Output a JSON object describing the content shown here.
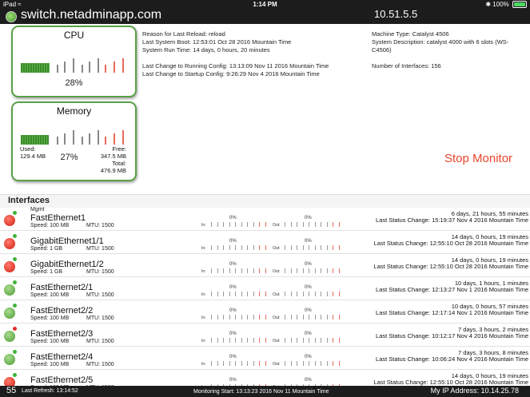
{
  "status_bar": {
    "device": "iPad",
    "time": "1:14 PM",
    "battery": "100%"
  },
  "header": {
    "hostname": "switch.netadminapp.com",
    "ip": "10.51.5.5"
  },
  "cpu": {
    "title": "CPU",
    "percent": "28%",
    "level": 0.28
  },
  "memory": {
    "title": "Memory",
    "percent": "27%",
    "level": 0.27,
    "used_label": "Used:",
    "used": "129.4 MB",
    "free_label": "Free:",
    "free": "347.5 MB",
    "total_label": "Total:",
    "total": "476.9 MB"
  },
  "system_info": {
    "reload_reason": "Reason for Last Reload: reload",
    "last_boot": "Last System Boot: 12:53:01 Oct 28 2016 Mountain Time",
    "run_time": "System Run Time: 14 days, 0 hours, 20 minutes",
    "running_config": "Last Change to Running Config: 13:13:09 Nov 11 2016 Mountain Time",
    "startup_config": "Last Change to Startup Config: 9:26:29 Nov 4 2016 Mountain Time",
    "machine_type": "Machine Type: Catalyst 4506",
    "description_line1": "System Description: catalyst 4000 with 6 slots (WS-",
    "description_line2": "C4506)",
    "interfaces_count": "Number of Interfaces: 156"
  },
  "stop_monitor_label": "Stop Monitor",
  "interfaces_title": "Interfaces",
  "interfaces": [
    {
      "status": "red",
      "badge": "g",
      "alias": "Mgmt",
      "name": "FastEthernet1",
      "speed": "Speed: 100 MB",
      "mtu": "MTU: 1500",
      "in_pct": "0%",
      "out_pct": "0%",
      "uptime": "6 days, 21 hours, 55 minutes",
      "last_change": "Last Status Change: 15:19:37 Nov 4 2016 Mountain Time"
    },
    {
      "status": "red",
      "badge": "g",
      "alias": "",
      "name": "GigabitEthernet1/1",
      "speed": "Speed: 1 GB",
      "mtu": "MTU: 1500",
      "in_pct": "0%",
      "out_pct": "0%",
      "uptime": "14 days, 0 hours, 19 minutes",
      "last_change": "Last Status Change: 12:55:10 Oct 28 2016 Mountain Time"
    },
    {
      "status": "red",
      "badge": "g",
      "alias": "",
      "name": "GigabitEthernet1/2",
      "speed": "Speed: 1 GB",
      "mtu": "MTU: 1500",
      "in_pct": "0%",
      "out_pct": "0%",
      "uptime": "14 days, 0 hours, 19 minutes",
      "last_change": "Last Status Change: 12:55:10 Oct 28 2016 Mountain Time"
    },
    {
      "status": "green",
      "badge": "g",
      "alias": "",
      "name": "FastEthernet2/1",
      "speed": "Speed: 100 MB",
      "mtu": "MTU: 1500",
      "in_pct": "0%",
      "out_pct": "0%",
      "uptime": "10 days, 1 hours, 1 minutes",
      "last_change": "Last Status Change: 12:13:27 Nov 1 2016 Mountain Time"
    },
    {
      "status": "green",
      "badge": "g",
      "alias": "",
      "name": "FastEthernet2/2",
      "speed": "Speed: 100 MB",
      "mtu": "MTU: 1500",
      "in_pct": "0%",
      "out_pct": "0%",
      "uptime": "10 days, 0 hours, 57 minutes",
      "last_change": "Last Status Change: 12:17:14 Nov 1 2016 Mountain Time"
    },
    {
      "status": "green",
      "badge": "r",
      "alias": "",
      "name": "FastEthernet2/3",
      "speed": "Speed: 100 MB",
      "mtu": "MTU: 1500",
      "in_pct": "0%",
      "out_pct": "0%",
      "uptime": "7 days, 3 hours, 2 minutes",
      "last_change": "Last Status Change: 10:12:17 Nov 4 2016 Mountain Time"
    },
    {
      "status": "green",
      "badge": "g",
      "alias": "",
      "name": "FastEthernet2/4",
      "speed": "Speed: 100 MB",
      "mtu": "MTU: 1500",
      "in_pct": "0%",
      "out_pct": "0%",
      "uptime": "7 days, 3 hours, 8 minutes",
      "last_change": "Last Status Change: 10:06:24 Nov 4 2016 Mountain Time"
    },
    {
      "status": "red",
      "badge": "g",
      "alias": "",
      "name": "FastEthernet2/5",
      "speed": "Speed: 100 MB",
      "mtu": "MTU: 1500",
      "in_pct": "0%",
      "out_pct": "0%",
      "uptime": "14 days, 0 hours, 19 minutes",
      "last_change": "Last Status Change: 12:55:10 Oct 28 2016 Mountain Time"
    }
  ],
  "row_labels": {
    "in": "In:",
    "out": "Out:"
  },
  "footer": {
    "count": "55",
    "last_refresh": "Last Refresh: 13:14:52",
    "monitoring_start": "Monitoring Start: 13:13:23 2016 Nov 11 Mountain Time",
    "my_ip": "My IP Address: 10.14.25.78"
  },
  "colors": {
    "accent_green": "#5aa047",
    "stop_red": "#e8452b",
    "bar_dark": "#1c1c1c"
  },
  "icons": {
    "connection": "green-status-dot-icon",
    "wifi": "wifi-icon",
    "bluetooth": "bluetooth-icon",
    "battery": "battery-icon"
  }
}
